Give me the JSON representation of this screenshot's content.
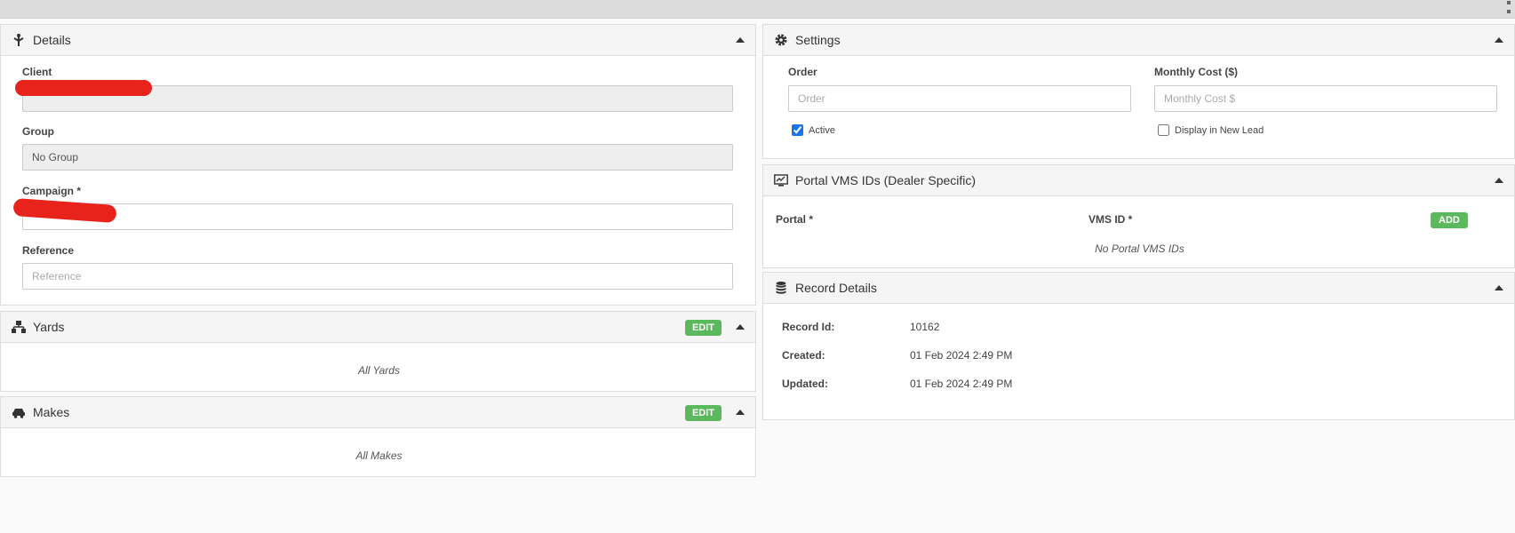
{
  "details": {
    "title": "Details",
    "client_label": "Client",
    "client_value": "",
    "group_label": "Group",
    "group_value": "No Group",
    "campaign_label": "Campaign *",
    "campaign_value": "",
    "reference_label": "Reference",
    "reference_placeholder": "Reference"
  },
  "yards": {
    "title": "Yards",
    "edit_label": "EDIT",
    "empty_text": "All Yards"
  },
  "makes": {
    "title": "Makes",
    "edit_label": "EDIT",
    "empty_text": "All Makes"
  },
  "settings": {
    "title": "Settings",
    "order_label": "Order",
    "order_placeholder": "Order",
    "cost_label": "Monthly Cost ($)",
    "cost_placeholder": "Monthly Cost $",
    "active_label": "Active",
    "active_checked": true,
    "display_label": "Display in New Lead",
    "display_checked": false
  },
  "portal": {
    "title": "Portal VMS IDs (Dealer Specific)",
    "col_portal": "Portal *",
    "col_vms": "VMS ID *",
    "add_label": "ADD",
    "empty_text": "No Portal VMS IDs"
  },
  "record": {
    "title": "Record Details",
    "rows": [
      {
        "label": "Record Id:",
        "value": "10162"
      },
      {
        "label": "Created:",
        "value": "01 Feb 2024 2:49 PM"
      },
      {
        "label": "Updated:",
        "value": "01 Feb 2024 2:49 PM"
      }
    ]
  },
  "colors": {
    "accent_green": "#5cb85c",
    "redaction": "#e8231c",
    "checkbox_blue": "#1a73e8"
  }
}
